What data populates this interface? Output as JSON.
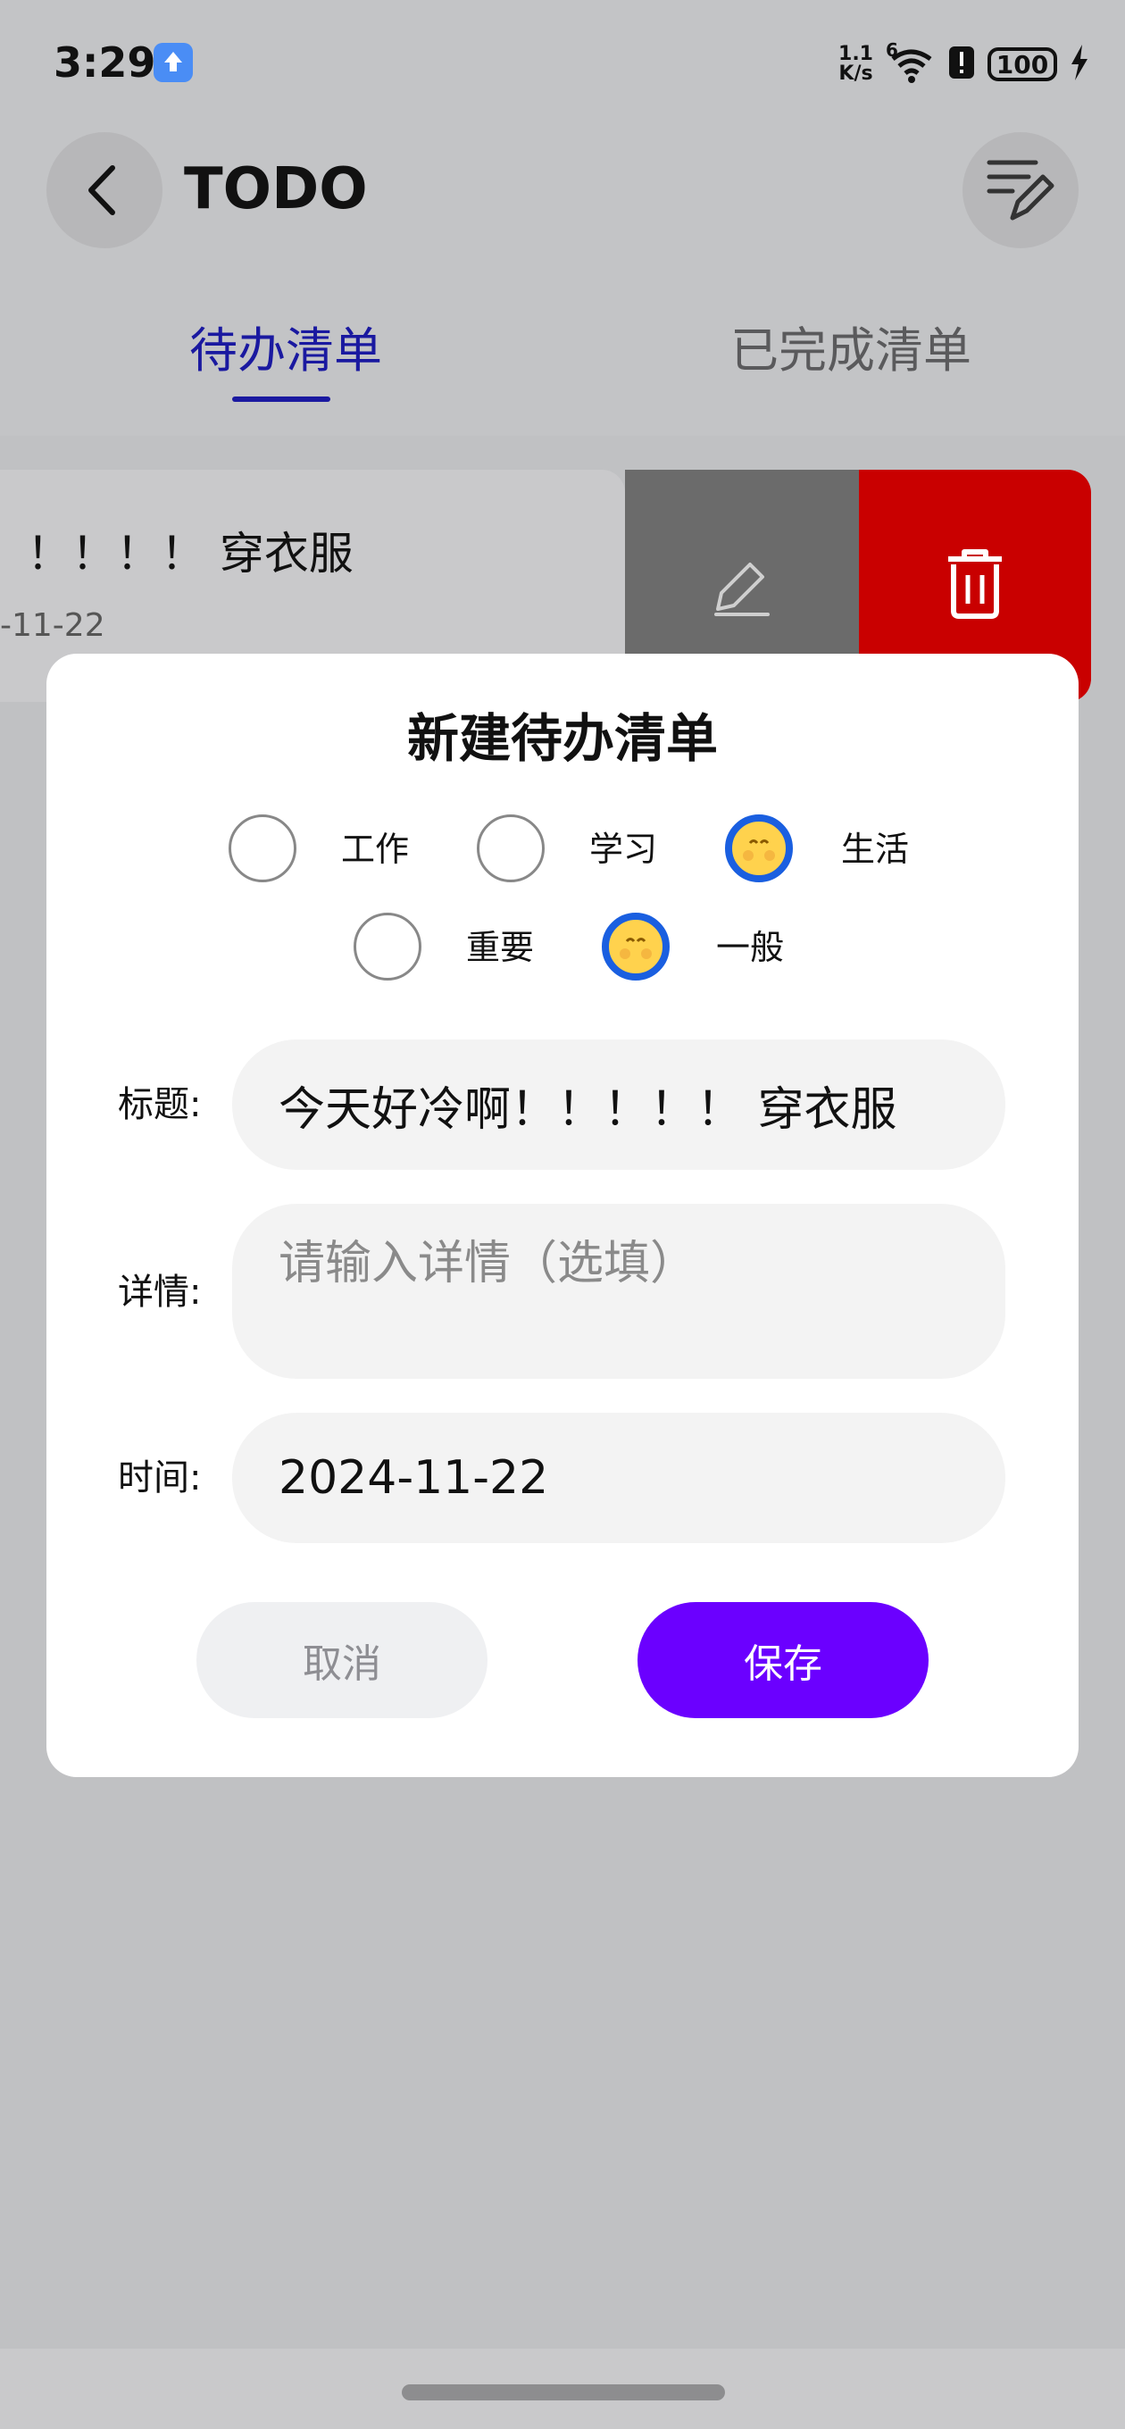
{
  "status_bar": {
    "time": "3:29",
    "net_speed_top": "1.1",
    "net_speed_bottom": "K/s",
    "signal_label": "6",
    "battery": "100"
  },
  "header": {
    "title": "TODO"
  },
  "tabs": [
    {
      "label": "待办清单",
      "active": true
    },
    {
      "label": "已完成清单",
      "active": false
    }
  ],
  "list": {
    "items": [
      {
        "title": "！！！！ 穿衣服",
        "date": "-11-22"
      }
    ]
  },
  "dialog": {
    "title": "新建待办清单",
    "categories": [
      {
        "label": "工作",
        "selected": false
      },
      {
        "label": "学习",
        "selected": false
      },
      {
        "label": "生活",
        "selected": true
      }
    ],
    "priorities": [
      {
        "label": "重要",
        "selected": false
      },
      {
        "label": "一般",
        "selected": true
      }
    ],
    "fields": {
      "title_label": "标题:",
      "title_value": "今天好冷啊！！！！！ 穿衣服",
      "detail_label": "详情:",
      "detail_placeholder": "请输入详情（选填）",
      "time_label": "时间:",
      "time_value": "2024-11-22"
    },
    "cancel_label": "取消",
    "save_label": "保存"
  },
  "colors": {
    "accent": "#6b00ff",
    "tab_active": "#1a19a0",
    "delete": "#c90000",
    "radio_selected": "#1a5fe0"
  }
}
